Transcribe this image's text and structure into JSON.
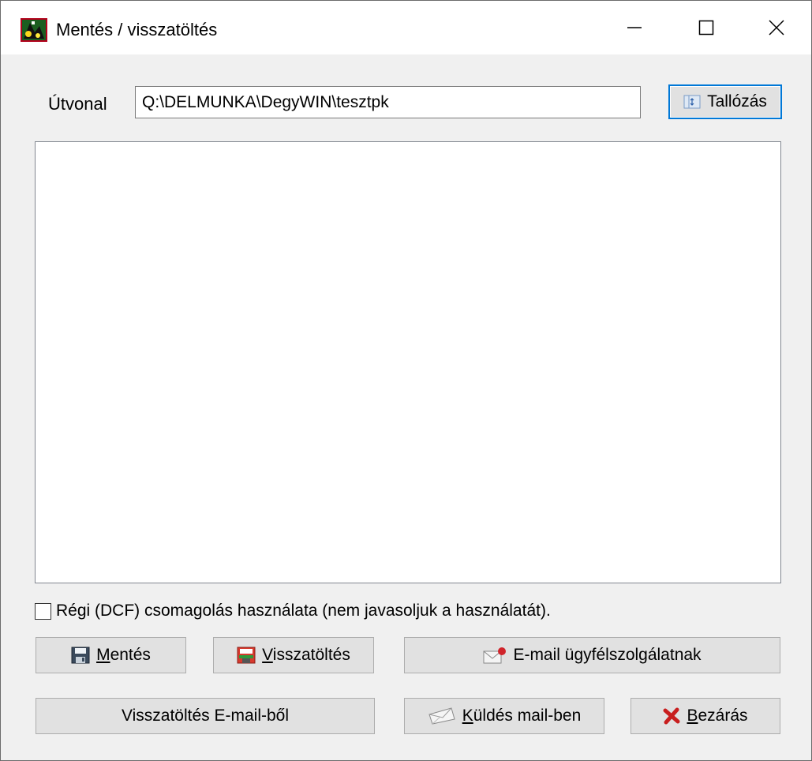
{
  "window": {
    "title": "Mentés / visszatöltés"
  },
  "path": {
    "label": "Útvonal",
    "value": "Q:\\DELMUNKA\\DegyWIN\\tesztpk",
    "browse_label": "Tallózás"
  },
  "file_list": {
    "items": []
  },
  "options": {
    "legacy_packing_label": "Régi (DCF) csomagolás használata (nem javasoljuk a használatát).",
    "legacy_packing_checked": false
  },
  "buttons": {
    "save": {
      "accel": "M",
      "rest": "entés"
    },
    "restore": {
      "accel": "V",
      "rest": "isszatöltés"
    },
    "email_support": "E-mail ügyfélszolgálatnak",
    "restore_from_email": "Visszatöltés E-mail-ből",
    "send_mail": {
      "accel": "K",
      "rest": "üldés mail-ben"
    },
    "close": {
      "accel": "B",
      "rest": "ezárás"
    }
  },
  "colors": {
    "focus_border": "#0078d7",
    "button_face": "#e1e1e1",
    "close_x": "#c81e1e"
  }
}
